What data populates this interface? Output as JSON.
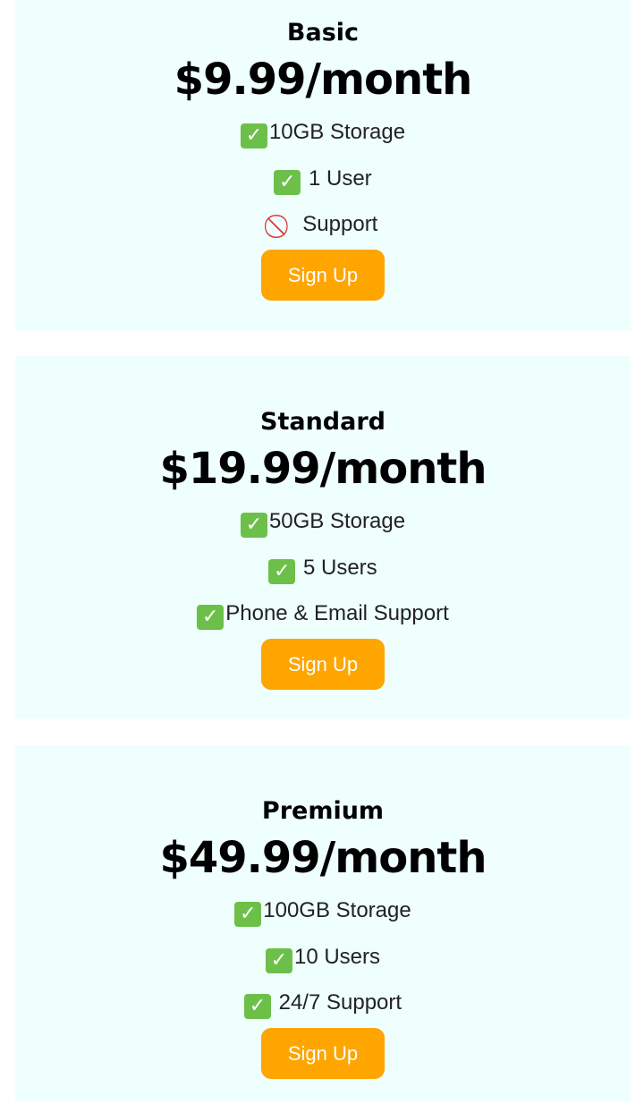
{
  "plans": [
    {
      "name": "Basic",
      "price": "$9.99/month",
      "features": [
        {
          "icon": "check-icon",
          "text": "10GB Storage"
        },
        {
          "icon": "check-icon",
          "text": " 1 User"
        },
        {
          "icon": "prohibited-icon",
          "text": " Support"
        }
      ],
      "button_label": "Sign Up"
    },
    {
      "name": "Standard",
      "price": "$19.99/month",
      "features": [
        {
          "icon": "check-icon",
          "text": "50GB Storage"
        },
        {
          "icon": "check-icon",
          "text": " 5 Users"
        },
        {
          "icon": "check-icon",
          "text": "Phone & Email Support"
        }
      ],
      "button_label": "Sign Up"
    },
    {
      "name": "Premium",
      "price": "$49.99/month",
      "features": [
        {
          "icon": "check-icon",
          "text": "100GB Storage"
        },
        {
          "icon": "check-icon",
          "text": "10 Users"
        },
        {
          "icon": "check-icon",
          "text": " 24/7 Support"
        }
      ],
      "button_label": "Sign Up"
    }
  ],
  "colors": {
    "card_background": "#effffd",
    "button_background": "#ffa500",
    "button_text": "#ffffff",
    "check_green": "#6cc04a",
    "prohibited_red": "#e03a3a"
  }
}
